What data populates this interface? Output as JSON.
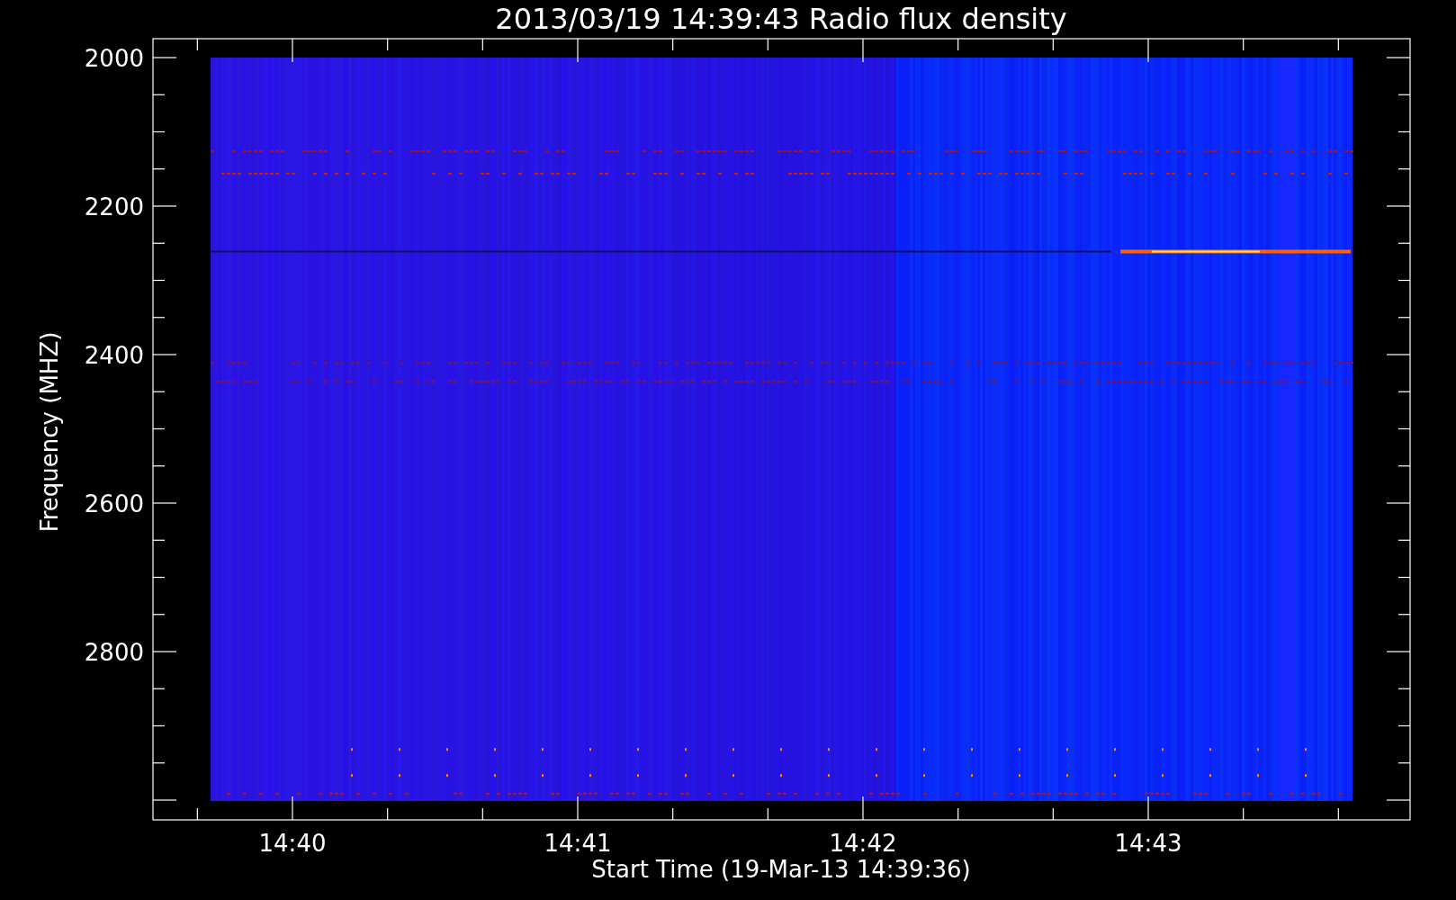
{
  "title": "2013/03/19 14:39:43 Radio flux density",
  "y_axis": {
    "label": "Frequency (MHZ)",
    "ticks": [
      "2000",
      "2200",
      "2400",
      "2600",
      "2800"
    ]
  },
  "x_axis": {
    "label": "Start Time (19-Mar-13 14:39:36)",
    "ticks": [
      "14:40",
      "14:41",
      "14:42",
      "14:43"
    ]
  }
}
